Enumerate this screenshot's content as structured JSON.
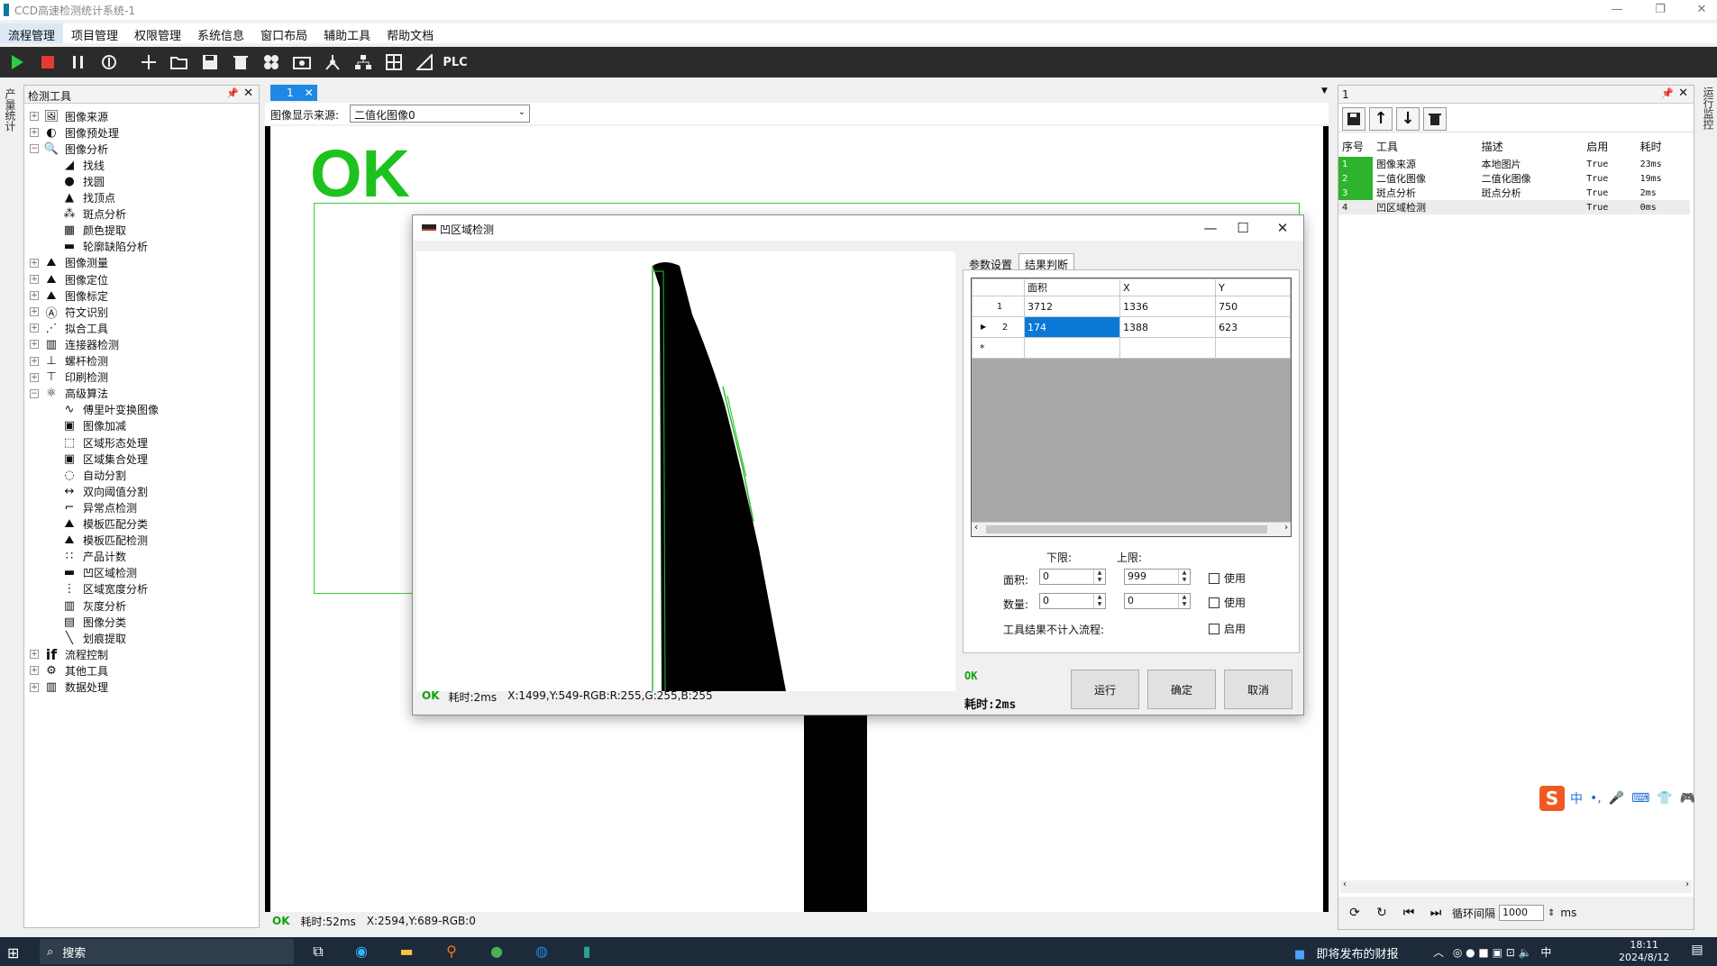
{
  "window": {
    "title": "CCD高速检测统计系统-1",
    "controls": {
      "minimize": "—",
      "restore": "❐",
      "close": "✕"
    }
  },
  "menu": [
    "流程管理",
    "项目管理",
    "权限管理",
    "系统信息",
    "窗口布局",
    "辅助工具",
    "帮助文档"
  ],
  "toolbar": {
    "plc_label": "PLC",
    "icons": [
      "play-icon",
      "stop-icon",
      "pause-icon",
      "loop-icon",
      "add-icon",
      "open-folder-icon",
      "save-icon",
      "delete-icon",
      "modules-icon",
      "camera-icon",
      "network-icon",
      "hierarchy-icon",
      "grid-icon",
      "ruler-icon"
    ]
  },
  "left_strip": {
    "label": "产量统计"
  },
  "tool_panel": {
    "title": "检测工具",
    "pin": "📌",
    "close": "✕",
    "items": [
      {
        "label": "图像来源",
        "level": 0,
        "expander": "+",
        "icon": "image-source-icon"
      },
      {
        "label": "图像预处理",
        "level": 0,
        "expander": "+",
        "icon": "preprocess-icon"
      },
      {
        "label": "图像分析",
        "level": 0,
        "expander": "−",
        "icon": "image-analysis-icon"
      },
      {
        "label": "找线",
        "level": 1,
        "icon": "find-line-icon"
      },
      {
        "label": "找圆",
        "level": 1,
        "icon": "find-circle-icon"
      },
      {
        "label": "找顶点",
        "level": 1,
        "icon": "find-vertex-icon"
      },
      {
        "label": "斑点分析",
        "level": 1,
        "icon": "blob-icon"
      },
      {
        "label": "颜色提取",
        "level": 1,
        "icon": "color-extract-icon"
      },
      {
        "label": "轮廓缺陷分析",
        "level": 1,
        "icon": "contour-defect-icon"
      },
      {
        "label": "图像测量",
        "level": 0,
        "expander": "+",
        "icon": "measure-icon"
      },
      {
        "label": "图像定位",
        "level": 0,
        "expander": "+",
        "icon": "locate-icon"
      },
      {
        "label": "图像标定",
        "level": 0,
        "expander": "+",
        "icon": "calibrate-icon"
      },
      {
        "label": "符文识别",
        "level": 0,
        "expander": "+",
        "icon": "ocr-icon"
      },
      {
        "label": "拟合工具",
        "level": 0,
        "expander": "+",
        "icon": "fit-icon"
      },
      {
        "label": "连接器检测",
        "level": 0,
        "expander": "+",
        "icon": "connector-icon"
      },
      {
        "label": "螺杆检测",
        "level": 0,
        "expander": "+",
        "icon": "screw-icon"
      },
      {
        "label": "印刷检测",
        "level": 0,
        "expander": "+",
        "icon": "print-icon"
      },
      {
        "label": "高级算法",
        "level": 0,
        "expander": "−",
        "icon": "advanced-icon"
      },
      {
        "label": "傅里叶变换图像",
        "level": 1,
        "icon": "fourier-icon"
      },
      {
        "label": "图像加减",
        "level": 1,
        "icon": "image-add-icon"
      },
      {
        "label": "区域形态处理",
        "level": 1,
        "icon": "morphology-icon"
      },
      {
        "label": "区域集合处理",
        "level": 1,
        "icon": "region-set-icon"
      },
      {
        "label": "自动分割",
        "level": 1,
        "icon": "auto-split-icon"
      },
      {
        "label": "双向阈值分割",
        "level": 1,
        "icon": "threshold-icon"
      },
      {
        "label": "异常点检测",
        "level": 1,
        "icon": "anomaly-icon"
      },
      {
        "label": "模板匹配分类",
        "level": 1,
        "icon": "template-classify-icon"
      },
      {
        "label": "模板匹配检测",
        "level": 1,
        "icon": "template-detect-icon"
      },
      {
        "label": "产品计数",
        "level": 1,
        "icon": "count-icon"
      },
      {
        "label": "凹区域检测",
        "level": 1,
        "icon": "concave-icon"
      },
      {
        "label": "区域宽度分析",
        "level": 1,
        "icon": "width-icon"
      },
      {
        "label": "灰度分析",
        "level": 1,
        "icon": "gray-icon"
      },
      {
        "label": "图像分类",
        "level": 1,
        "icon": "classify-icon"
      },
      {
        "label": "划痕提取",
        "level": 1,
        "icon": "scratch-icon"
      },
      {
        "label": "流程控制",
        "level": 0,
        "expander": "+",
        "icon": "if-icon"
      },
      {
        "label": "其他工具",
        "level": 0,
        "expander": "+",
        "icon": "other-tools-icon"
      },
      {
        "label": "数据处理",
        "level": 0,
        "expander": "+",
        "icon": "data-icon"
      }
    ]
  },
  "main": {
    "tab_label": "1",
    "source_label": "图像显示来源:",
    "source_value": "二值化图像0",
    "ok_text": "OK",
    "status": {
      "result": "OK",
      "time": "耗时:52ms",
      "coords": "X:2594,Y:689-RGB:0"
    }
  },
  "dialog": {
    "title": "凹区域检测",
    "tabs": [
      "参数设置",
      "结果判断"
    ],
    "table": {
      "columns": [
        "面积",
        "X",
        "Y"
      ],
      "rows": [
        {
          "n": "1",
          "area": "3712",
          "x": "1336",
          "y": "750"
        },
        {
          "n": "2",
          "area": "174",
          "x": "1388",
          "y": "623"
        }
      ],
      "new_row_marker": "*",
      "current_row_marker": "▶"
    },
    "limits": {
      "lower_label": "下限:",
      "upper_label": "上限:",
      "area_label": "面积:",
      "count_label": "数量:",
      "area_lower": "0",
      "area_upper": "999",
      "count_lower": "0",
      "count_upper": "0",
      "use_label": "使用",
      "exclude_label": "工具结果不计入流程:",
      "enable_label": "启用"
    },
    "result": "OK",
    "time": "耗时:2ms",
    "image_status": {
      "result": "OK",
      "time": "耗时:2ms",
      "coords": "X:1499,Y:549-RGB:R:255,G:255,B:255"
    },
    "buttons": {
      "run": "运行",
      "ok": "确定",
      "cancel": "取消"
    }
  },
  "right_panel": {
    "title": "1",
    "columns": [
      "序号",
      "工具",
      "描述",
      "启用",
      "耗时"
    ],
    "rows": [
      {
        "n": "1",
        "tool": "图像来源",
        "desc": "本地图片",
        "enabled": "True",
        "time": "23ms",
        "active": true
      },
      {
        "n": "2",
        "tool": "二值化图像",
        "desc": "二值化图像",
        "enabled": "True",
        "time": "19ms",
        "active": true
      },
      {
        "n": "3",
        "tool": "斑点分析",
        "desc": "斑点分析",
        "enabled": "True",
        "time": "2ms",
        "active": true
      },
      {
        "n": "4",
        "tool": "凹区域检测",
        "desc": "",
        "enabled": "True",
        "time": "0ms",
        "active": false
      }
    ],
    "loop_label": "循环间隔",
    "loop_value": "1000",
    "loop_unit": "ms"
  },
  "right_strip": {
    "label": "运行监控"
  },
  "ime": {
    "items": [
      "中",
      "•,",
      "🎤",
      "⌨",
      "👕",
      "🎮"
    ]
  },
  "taskbar": {
    "search_placeholder": "搜索",
    "news": "即将发布的财报",
    "tray_lang": "中",
    "time": "18:11",
    "date": "2024/8/12"
  },
  "colors": {
    "ok_green": "#1ec21e",
    "selection_blue": "#0a78d7",
    "row_active_green": "#2db32d",
    "toolbar_bg": "#2b2b2b"
  }
}
